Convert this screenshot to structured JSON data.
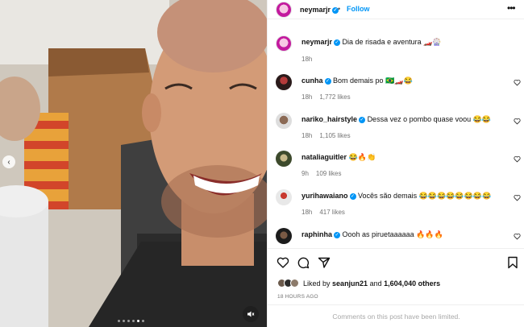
{
  "post": {
    "author": "neymarjr",
    "follow_label": "Follow",
    "separator": "•",
    "more_icon": "more-horizontal-icon",
    "caption": "Dia de risada e aventura 🏎️🎡",
    "caption_time": "18h"
  },
  "comments": [
    {
      "user": "cunha",
      "verified": true,
      "text": "Bom demais po 🇧🇷🏎️😂",
      "time": "18h",
      "likes": "1,772 likes"
    },
    {
      "user": "nariko_hairstyle",
      "verified": true,
      "text": "Dessa vez o pombo quase voou 😂😂",
      "time": "18h",
      "likes": "1,105 likes"
    },
    {
      "user": "nataliaguitler",
      "verified": false,
      "text": "😂🔥👏",
      "time": "9h",
      "likes": "109 likes"
    },
    {
      "user": "yurihawaiano",
      "verified": true,
      "text": "Vocês são demais 😂😂😂😂😂😂😂😂",
      "time": "18h",
      "likes": "417 likes"
    },
    {
      "user": "raphinha",
      "verified": true,
      "text": "Oooh as piruetaaaaaa 🔥🔥🔥",
      "time": "",
      "likes": ""
    }
  ],
  "actions": {
    "liked_by_prefix": "Liked by",
    "liked_by_user": "seanjun21",
    "liked_and": "and",
    "liked_count": "1,604,040 others",
    "time_ago": "18 HOURS AGO",
    "comments_limited": "Comments on this post have been limited."
  },
  "media": {
    "slide_count": 6,
    "active_slide": 5
  }
}
